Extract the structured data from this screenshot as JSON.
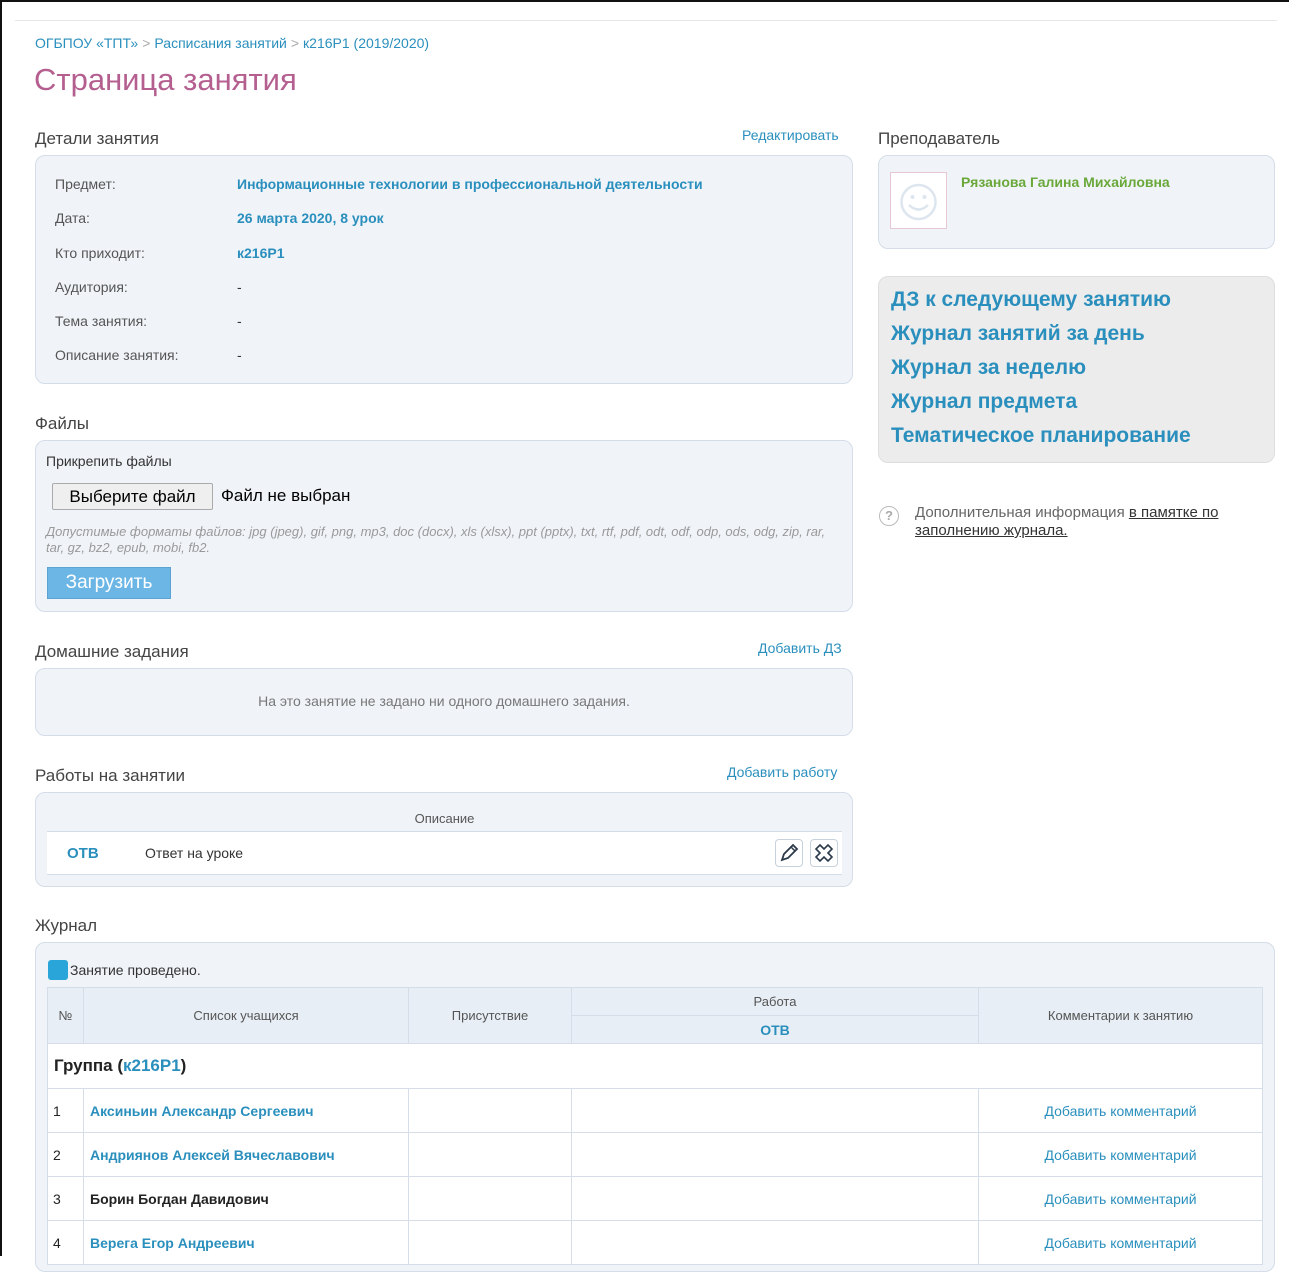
{
  "breadcrumb": [
    "ОГБПОУ «ТПТ»",
    "Расписания занятий",
    "к216Р1 (2019/2020)"
  ],
  "page_title": "Страница занятия",
  "details": {
    "title": "Детали занятия",
    "edit_label": "Редактировать",
    "rows": [
      {
        "label": "Предмет:",
        "value": "Информационные технологии в профессиональной деятельности"
      },
      {
        "label": "Дата:",
        "value": "26 марта 2020, 8 урок"
      },
      {
        "label": "Кто приходит:",
        "value": "к216Р1"
      },
      {
        "label": "Аудитория:",
        "value": "-"
      },
      {
        "label": "Тема занятия:",
        "value": "-"
      },
      {
        "label": "Описание занятия:",
        "value": "-"
      }
    ]
  },
  "files": {
    "title": "Файлы",
    "attach_label": "Прикрепить файлы",
    "choose_button": "Выберите файл",
    "no_file": "Файл не выбран",
    "formats": "Допустимые форматы файлов: jpg (jpeg), gif, png, mp3, doc (docx), xls (xlsx), ppt (pptx), txt, rtf, pdf, odt, odf, odp, ods, odg, zip, rar, tar, gz, bz2, epub, mobi, fb2.",
    "upload_button": "Загрузить"
  },
  "homework": {
    "title": "Домашние задания",
    "add_label": "Добавить ДЗ",
    "empty_text": "На это занятие не задано ни одного домашнего задания."
  },
  "works": {
    "title": "Работы на занятии",
    "add_label": "Добавить работу",
    "col_description": "Описание",
    "items": [
      {
        "code": "ОТВ",
        "description": "Ответ на уроке"
      }
    ]
  },
  "journal": {
    "title": "Журнал",
    "conducted_label": "Занятие проведено.",
    "headers": {
      "num": "№",
      "students": "Список учащихся",
      "presence": "Присутствие",
      "work": "Работа",
      "work_code": "ОТВ",
      "comments": "Комментарии к занятию"
    },
    "group_prefix": "Группа (",
    "group_name": "к216Р1",
    "group_suffix": ")",
    "students": [
      {
        "num": "1",
        "name": "Аксиньин Александр Сергеевич",
        "comment": "Добавить комментарий"
      },
      {
        "num": "2",
        "name": "Андриянов Алексей Вячеславович",
        "comment": "Добавить комментарий"
      },
      {
        "num": "3",
        "name": "Борин Богдан Давидович",
        "comment": "Добавить комментарий"
      },
      {
        "num": "4",
        "name": "Верега Егор Андреевич",
        "comment": "Добавить комментарий"
      }
    ]
  },
  "teacher": {
    "title": "Преподаватель",
    "name": "Рязанова Галина Михайловна"
  },
  "side_links": [
    "ДЗ к следующему занятию",
    "Журнал занятий за день",
    "Журнал за неделю",
    "Журнал предмета",
    "Тематическое планирование"
  ],
  "info": {
    "text": "Дополнительная информация ",
    "link": "в памятке по заполнению журнала."
  },
  "colors": {
    "link": "#2a8fbd",
    "title": "#b45f8f",
    "teacher_name": "#6aa83a",
    "box_bg": "#f0f4f9",
    "upload_btn": "#6cb6e6"
  }
}
